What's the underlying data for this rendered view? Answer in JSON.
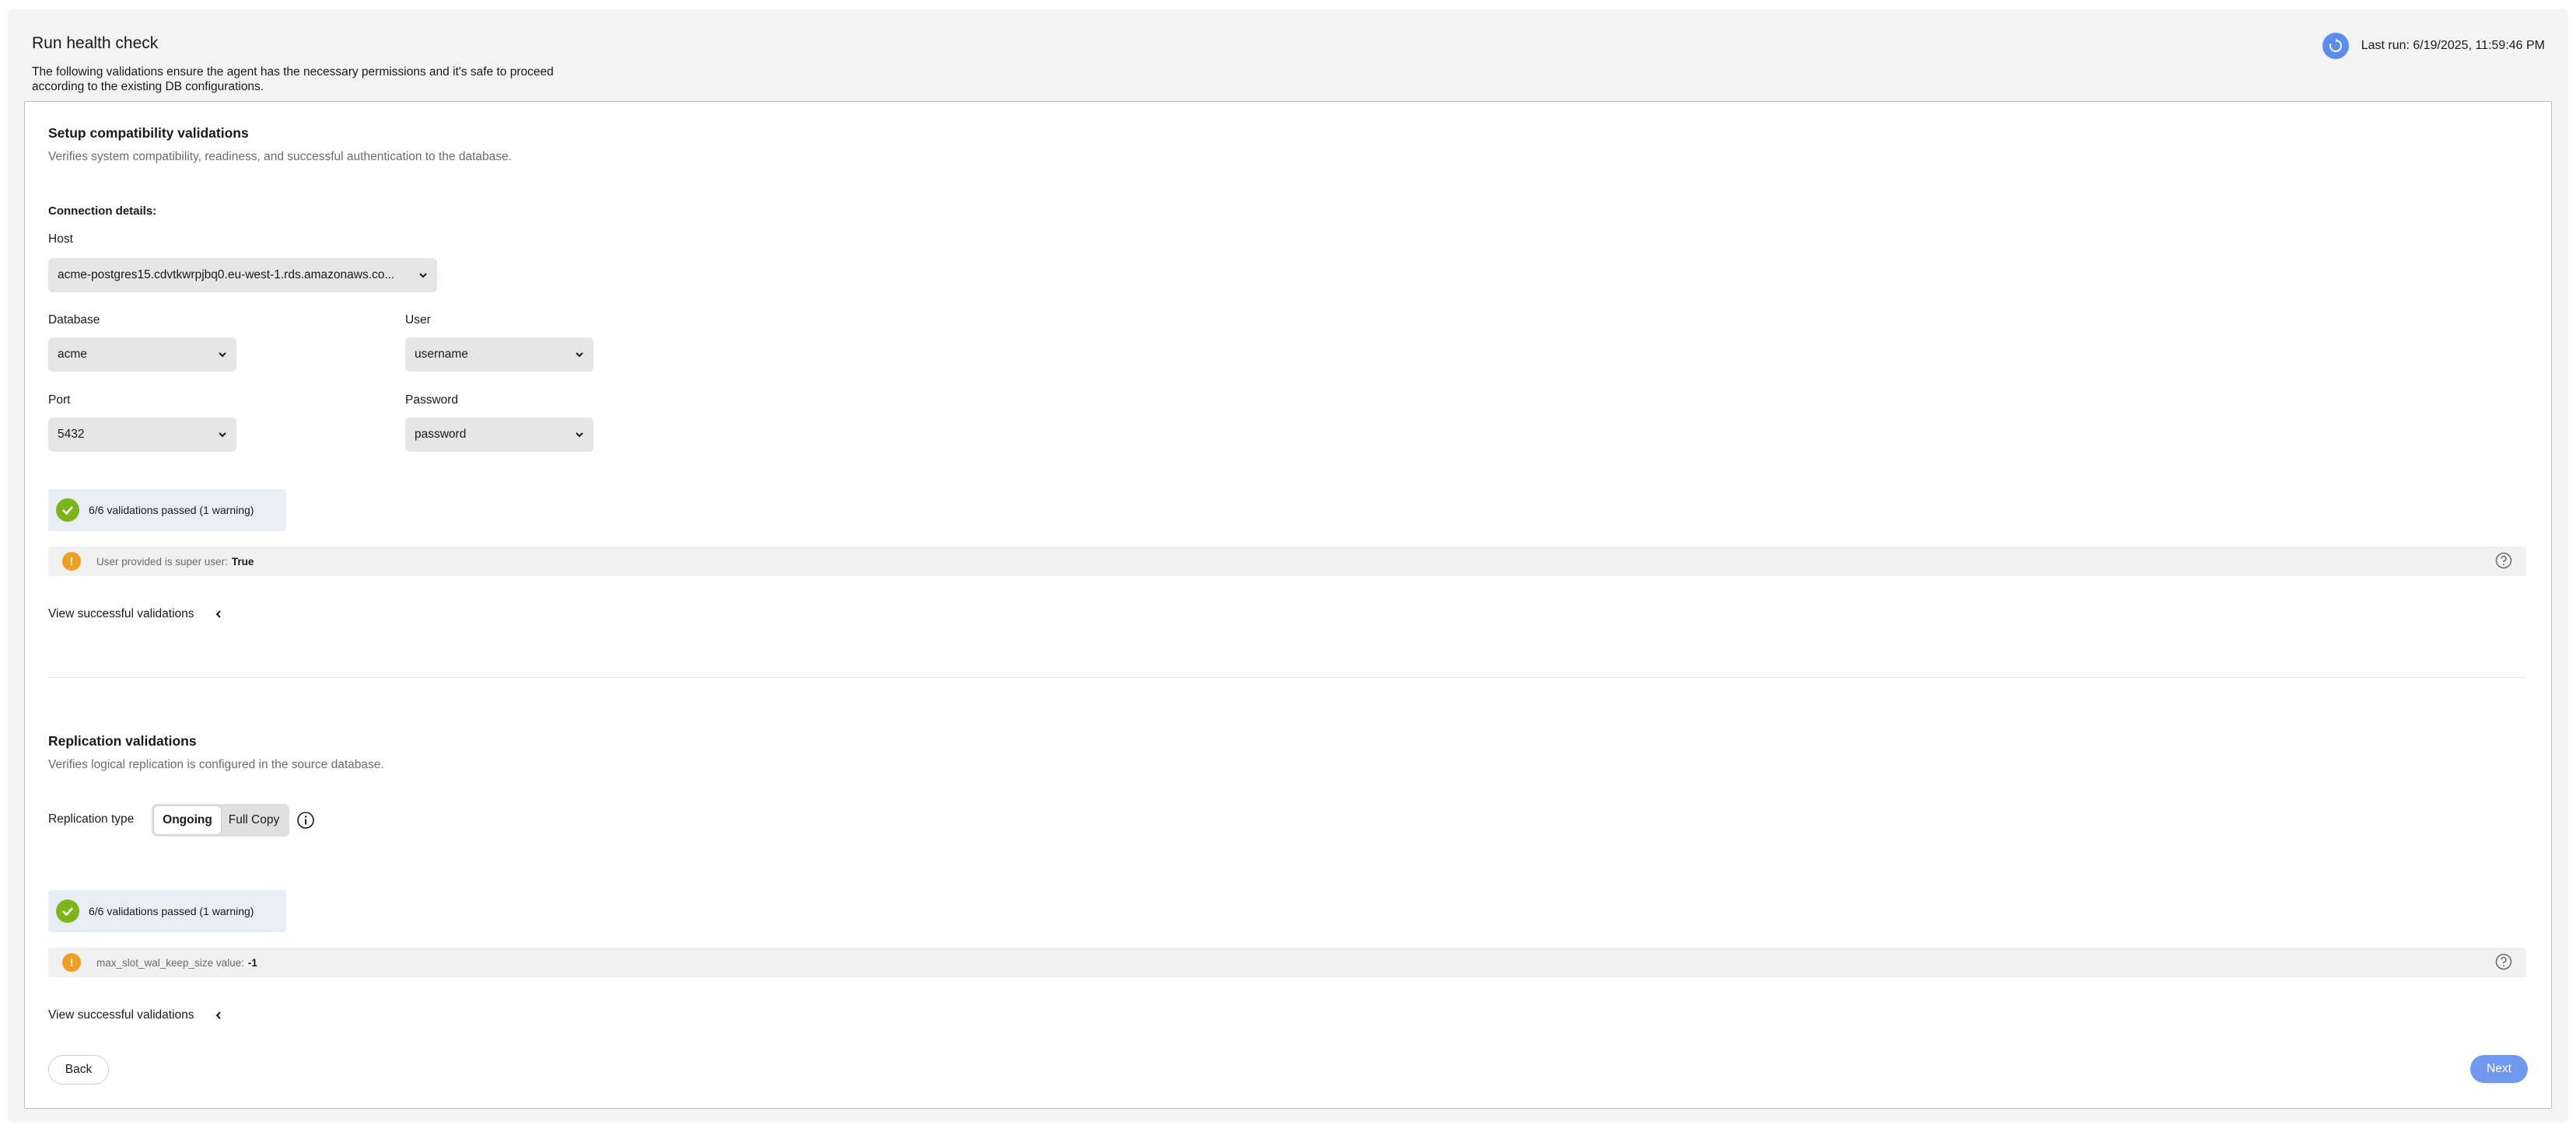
{
  "header": {
    "title": "Run health check",
    "description": "The following validations ensure the agent has the necessary permissions and it's safe to proceed according to the existing DB configurations.",
    "last_run": "Last run: 6/19/2025, 11:59:46 PM"
  },
  "setup": {
    "title": "Setup compatibility validations",
    "subtitle": "Verifies system compatibility, readiness, and successful authentication to the database.",
    "connection_label": "Connection details:",
    "host_label": "Host",
    "host_value": "acme-postgres15.cdvtkwrpjbq0.eu-west-1.rds.amazonaws.co...",
    "database_label": "Database",
    "database_value": "acme",
    "user_label": "User",
    "user_value": "username",
    "port_label": "Port",
    "port_value": "5432",
    "password_label": "Password",
    "password_value": "password",
    "result": "6/6 validations passed (1 warning)",
    "warning_text": "User provided is super user:",
    "warning_value": "True",
    "view_successful": "View successful validations"
  },
  "replication": {
    "title": "Replication validations",
    "subtitle": "Verifies logical replication is configured in the source database.",
    "type_label": "Replication type",
    "type_options": [
      "Ongoing",
      "Full Copy"
    ],
    "type_selected": "Ongoing",
    "result": "6/6 validations passed (1 warning)",
    "warning_text": "max_slot_wal_keep_size value:",
    "warning_value": "-1",
    "view_successful": "View successful validations"
  },
  "footer": {
    "back_label": "Back",
    "next_label": "Next"
  },
  "colors": {
    "accent": "#6f98ee",
    "success": "#7cb518",
    "warning": "#f0a020"
  },
  "icons": [
    "refresh-icon",
    "chevron-down-icon",
    "check-icon",
    "warning-icon",
    "help-icon",
    "chevron-left-icon",
    "info-icon"
  ]
}
